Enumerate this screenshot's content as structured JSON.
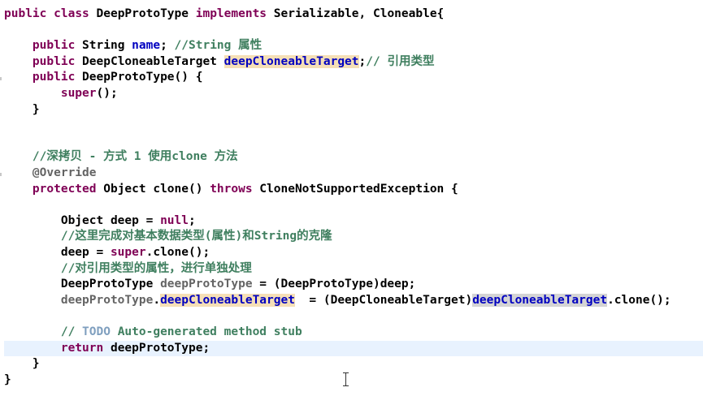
{
  "editor": {
    "lines": [
      {
        "tokens": [
          {
            "t": "public",
            "c": "kw"
          },
          {
            "t": " "
          },
          {
            "t": "class",
            "c": "kw"
          },
          {
            "t": " DeepProtoType "
          },
          {
            "t": "implements",
            "c": "kw"
          },
          {
            "t": " Serializable, Cloneable{"
          }
        ]
      },
      {
        "tokens": []
      },
      {
        "tokens": [
          {
            "t": "    "
          },
          {
            "t": "public",
            "c": "kw"
          },
          {
            "t": " String "
          },
          {
            "t": "name",
            "c": "fld"
          },
          {
            "t": "; "
          },
          {
            "t": "//String 属性",
            "c": "cmt"
          }
        ]
      },
      {
        "tokens": [
          {
            "t": "    "
          },
          {
            "t": "public",
            "c": "kw"
          },
          {
            "t": " DeepCloneableTarget "
          },
          {
            "t": "deepCloneableTarget",
            "c": "fld occ-read"
          },
          {
            "t": ";"
          },
          {
            "t": "// 引用类型",
            "c": "cmt"
          }
        ]
      },
      {
        "tokens": [
          {
            "t": "    "
          },
          {
            "t": "public",
            "c": "kw"
          },
          {
            "t": " DeepProtoType() {"
          }
        ]
      },
      {
        "tokens": [
          {
            "t": "        "
          },
          {
            "t": "super",
            "c": "kw"
          },
          {
            "t": "();"
          }
        ]
      },
      {
        "tokens": [
          {
            "t": "    }"
          }
        ]
      },
      {
        "tokens": []
      },
      {
        "tokens": []
      },
      {
        "tokens": [
          {
            "t": "    "
          },
          {
            "t": "//深拷贝 - 方式 1 使用clone 方法",
            "c": "cmt"
          }
        ]
      },
      {
        "tokens": [
          {
            "t": "    "
          },
          {
            "t": "@Override",
            "c": "ann"
          }
        ]
      },
      {
        "tokens": [
          {
            "t": "    "
          },
          {
            "t": "protected",
            "c": "kw"
          },
          {
            "t": " Object clone() "
          },
          {
            "t": "throws",
            "c": "kw"
          },
          {
            "t": " CloneNotSupportedException {"
          }
        ]
      },
      {
        "tokens": []
      },
      {
        "tokens": [
          {
            "t": "        Object deep = "
          },
          {
            "t": "null",
            "c": "kw"
          },
          {
            "t": ";"
          }
        ]
      },
      {
        "tokens": [
          {
            "t": "        "
          },
          {
            "t": "//这里完成对基本数据类型(属性)和String的克隆",
            "c": "cmt"
          }
        ]
      },
      {
        "tokens": [
          {
            "t": "        deep = "
          },
          {
            "t": "super",
            "c": "kw"
          },
          {
            "t": ".clone();"
          }
        ]
      },
      {
        "tokens": [
          {
            "t": "        "
          },
          {
            "t": "//对引用类型的属性，进行单独处理",
            "c": "cmt"
          }
        ]
      },
      {
        "tokens": [
          {
            "t": "        DeepProtoType "
          },
          {
            "t": "deepProtoType",
            "c": "ann"
          },
          {
            "t": " = (DeepProtoType)deep;"
          }
        ]
      },
      {
        "tokens": [
          {
            "t": "        "
          },
          {
            "t": "deepProtoType",
            "c": "ann"
          },
          {
            "t": "."
          },
          {
            "t": "deepCloneableTarget",
            "c": "fld occ-read"
          },
          {
            "t": "  = (DeepCloneableTarget)"
          },
          {
            "t": "deepCloneableTarget",
            "c": "fld occ-write"
          },
          {
            "t": ".clone();"
          }
        ]
      },
      {
        "tokens": []
      },
      {
        "tokens": [
          {
            "t": "        "
          },
          {
            "t": "// ",
            "c": "cmt"
          },
          {
            "t": "TODO",
            "c": "todo"
          },
          {
            "t": " Auto-generated method stub",
            "c": "cmt"
          }
        ]
      },
      {
        "tokens": [
          {
            "t": "        "
          },
          {
            "t": "return",
            "c": "kw"
          },
          {
            "t": " deepProtoType;"
          }
        ],
        "current": true
      },
      {
        "tokens": [
          {
            "t": "    }"
          }
        ]
      },
      {
        "tokens": [
          {
            "t": "}"
          }
        ]
      }
    ]
  }
}
